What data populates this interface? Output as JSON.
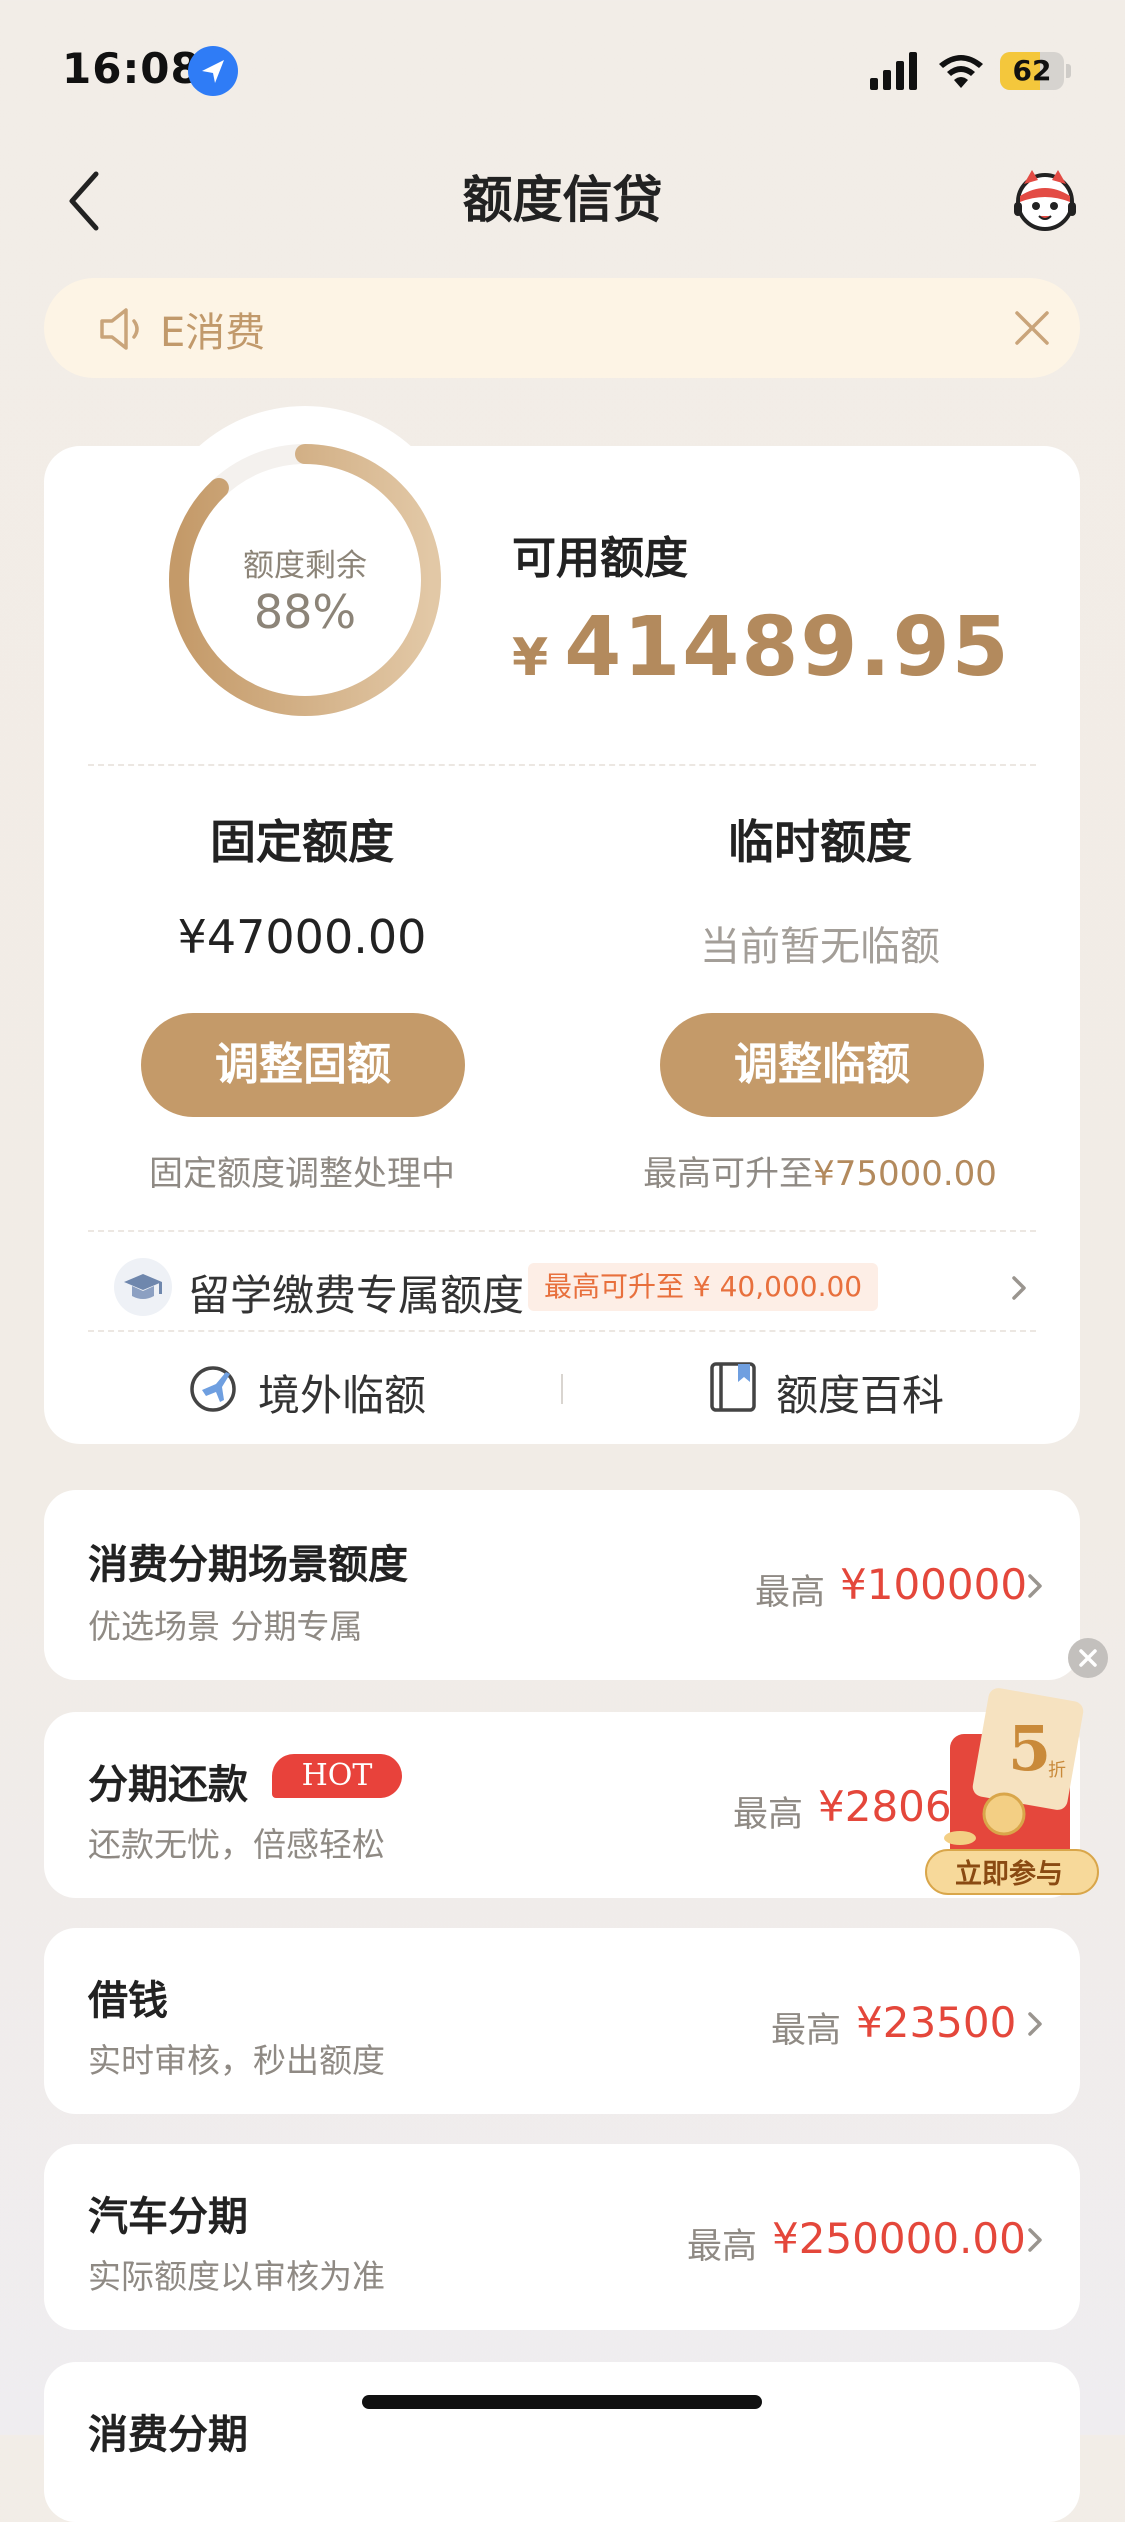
{
  "status_bar": {
    "time": "16:08",
    "battery": "62",
    "battery_fraction": 0.62
  },
  "nav": {
    "title": "额度信贷"
  },
  "notice": {
    "text": "E消费"
  },
  "credit": {
    "ring_label": "额度剩余",
    "ring_percent": "88%",
    "ring_fraction": 0.88,
    "available_label": "可用额度",
    "available_currency": "¥",
    "available_amount": "41489.95",
    "fixed": {
      "title": "固定额度",
      "value": "¥47000.00",
      "button": "调整固额",
      "note": "固定额度调整处理中"
    },
    "temp": {
      "title": "临时额度",
      "value": "当前暂无临额",
      "button": "调整临额",
      "note_prefix": "最高可升至",
      "note_amount": "¥75000.00"
    },
    "study": {
      "label": "留学缴费专属额度",
      "badge": "最高可升至 ¥ 40,000.00"
    },
    "tools": [
      {
        "label": "境外临额",
        "icon": "plane-globe-icon"
      },
      {
        "label": "额度百科",
        "icon": "book-icon"
      }
    ]
  },
  "products": [
    {
      "title": "消费分期场景额度",
      "subtitle": "优选场景 分期专属",
      "max_label": "最高",
      "amount": "¥100000"
    },
    {
      "title": "分期还款",
      "badge": "HOT",
      "subtitle": "还款无忧，倍感轻松",
      "max_label": "最高",
      "amount": "¥2806."
    },
    {
      "title": "借钱",
      "subtitle": "实时审核，秒出额度",
      "max_label": "最高",
      "amount": "¥23500"
    },
    {
      "title": "汽车分期",
      "subtitle": "实际额度以审核为准",
      "max_label": "最高",
      "amount": "¥250000.00"
    },
    {
      "title": "消费分期"
    }
  ],
  "promo": {
    "discount": "5",
    "discount_unit": "折",
    "button": "立即参与"
  },
  "colors": {
    "gold": "#c49a69",
    "gold_text": "#b38a5d",
    "red_amount": "#e4473b",
    "hot_badge": "#e8423b",
    "notice_bg": "#fdf4e5"
  }
}
